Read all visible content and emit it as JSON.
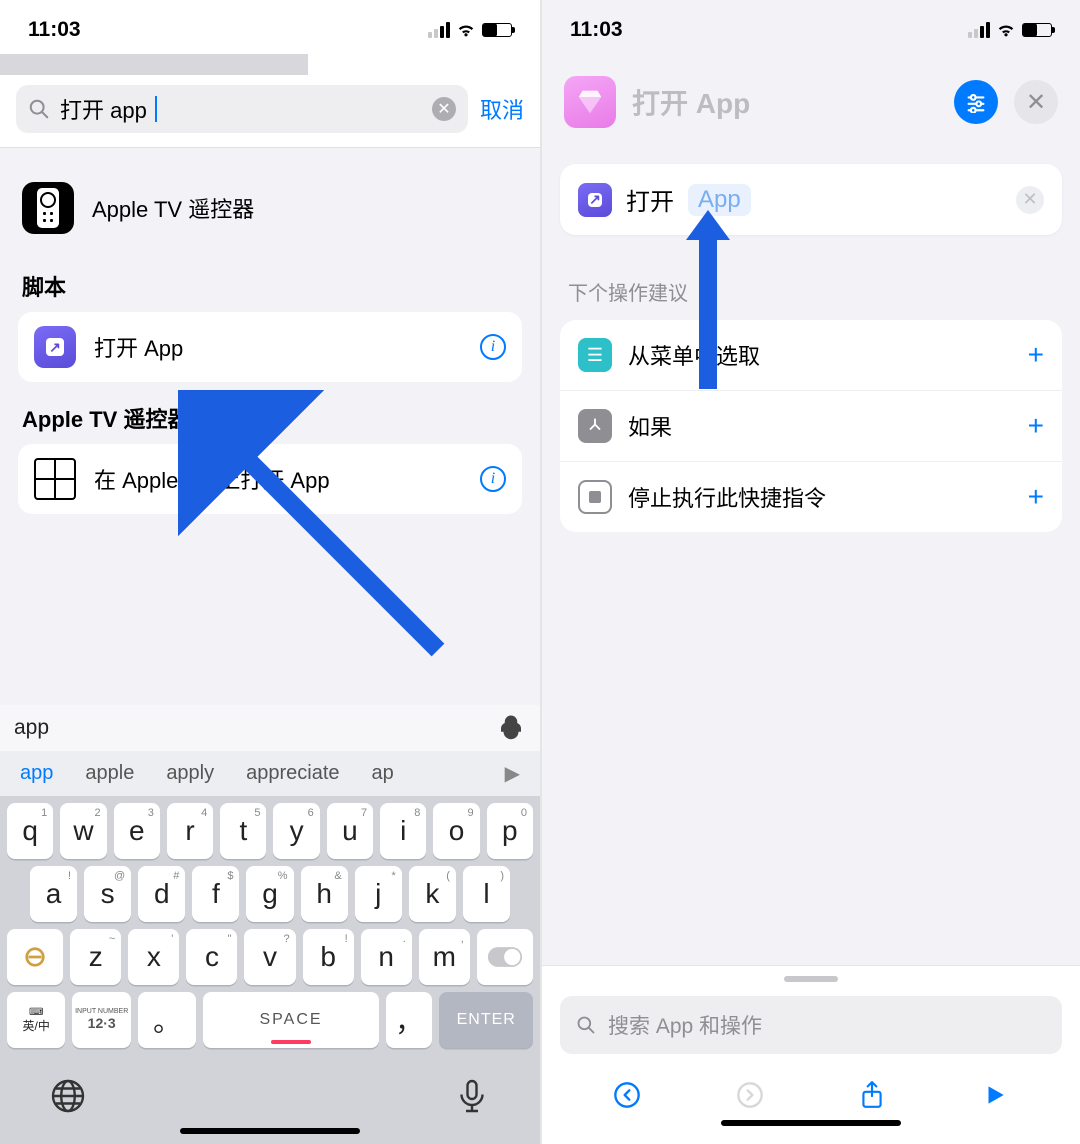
{
  "left": {
    "status_time": "11:03",
    "search_value": "打开 app",
    "cancel": "取消",
    "result_top": "Apple TV 遥控器",
    "section_scripts": "脚本",
    "result_open_app": "打开 App",
    "section_appletv": "Apple TV 遥控器",
    "result_open_on_tv": "在 Apple TV 上打开 App",
    "kb_word": "app",
    "kb_predictions": [
      "app",
      "apple",
      "apply",
      "appreciate",
      "ap"
    ],
    "kb_row1": [
      "q",
      "w",
      "e",
      "r",
      "t",
      "y",
      "u",
      "i",
      "o",
      "p"
    ],
    "kb_row1_sup": [
      "1",
      "2",
      "3",
      "4",
      "5",
      "6",
      "7",
      "8",
      "9",
      "0"
    ],
    "kb_row2": [
      "a",
      "s",
      "d",
      "f",
      "g",
      "h",
      "j",
      "k",
      "l"
    ],
    "kb_row2_sup": [
      "!",
      "@",
      "#",
      "$",
      "%",
      "&",
      "*",
      "(",
      ")"
    ],
    "kb_row3": [
      "z",
      "x",
      "c",
      "v",
      "b",
      "n",
      "m"
    ],
    "kb_row3_sup": [
      "~",
      "'",
      "\"",
      "?",
      "!",
      ".",
      ","
    ],
    "kb_space": "SPACE",
    "kb_enter": "ENTER",
    "kb_lang_cn": "英/中",
    "kb_num_top": "INPUT NUMBER",
    "kb_num": "12·3",
    "kb_dot": "。",
    "kb_comma": "，"
  },
  "right": {
    "status_time": "11:03",
    "title": "打开 App",
    "action_open": "打开",
    "action_param": "App",
    "suggestion_header": "下个操作建议",
    "sugg1": "从菜单中选取",
    "sugg2": "如果",
    "sugg3": "停止执行此快捷指令",
    "search_placeholder": "搜索 App 和操作"
  }
}
